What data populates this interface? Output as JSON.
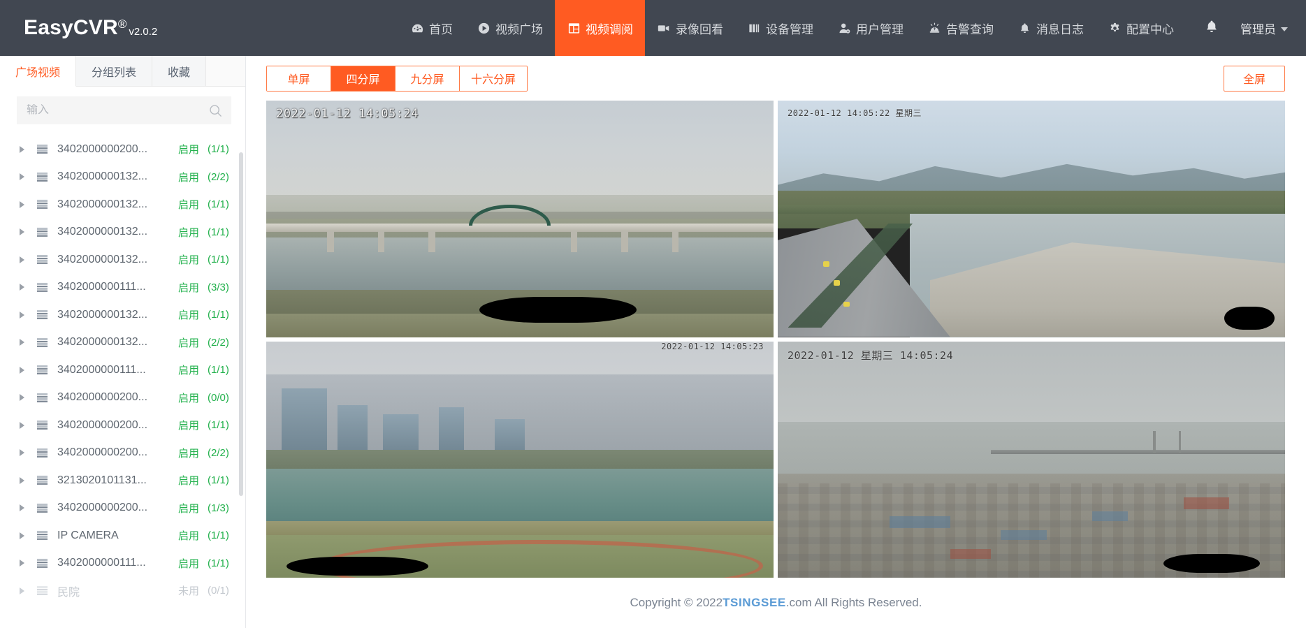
{
  "app": {
    "brand_name": "EasyCVR",
    "brand_reg": "®",
    "brand_version": "v2.0.2",
    "accent_color": "#ff5b22",
    "header_bg": "#414751",
    "enabled_color": "#22b14c"
  },
  "nav": {
    "items": [
      {
        "label": "首页",
        "icon": "dashboard-icon",
        "active": false
      },
      {
        "label": "视频广场",
        "icon": "play-circle-icon",
        "active": false
      },
      {
        "label": "视频调阅",
        "icon": "layout-icon",
        "active": true
      },
      {
        "label": "录像回看",
        "icon": "video-camera-icon",
        "active": false
      },
      {
        "label": "设备管理",
        "icon": "server-icon",
        "active": false
      },
      {
        "label": "用户管理",
        "icon": "user-gear-icon",
        "active": false
      },
      {
        "label": "告警查询",
        "icon": "alarm-icon",
        "active": false
      },
      {
        "label": "消息日志",
        "icon": "bell-icon",
        "active": false
      },
      {
        "label": "配置中心",
        "icon": "gear-icon",
        "active": false
      }
    ],
    "notification_icon": "bell-icon",
    "user_label": "管理员",
    "user_caret_icon": "chevron-down-icon"
  },
  "sidebar": {
    "tabs": [
      {
        "label": "广场视频",
        "active": true
      },
      {
        "label": "分组列表",
        "active": false
      },
      {
        "label": "收藏",
        "active": false
      }
    ],
    "search": {
      "placeholder": "输入",
      "value": "",
      "icon": "search-icon"
    },
    "status_enabled": "启用",
    "status_disabled": "未用",
    "tree": [
      {
        "label": "3402000000200...",
        "status": "启用",
        "count": "(1/1)",
        "enabled": true
      },
      {
        "label": "3402000000132...",
        "status": "启用",
        "count": "(2/2)",
        "enabled": true
      },
      {
        "label": "3402000000132...",
        "status": "启用",
        "count": "(1/1)",
        "enabled": true
      },
      {
        "label": "3402000000132...",
        "status": "启用",
        "count": "(1/1)",
        "enabled": true
      },
      {
        "label": "3402000000132...",
        "status": "启用",
        "count": "(1/1)",
        "enabled": true
      },
      {
        "label": "3402000000111...",
        "status": "启用",
        "count": "(3/3)",
        "enabled": true
      },
      {
        "label": "3402000000132...",
        "status": "启用",
        "count": "(1/1)",
        "enabled": true
      },
      {
        "label": "3402000000132...",
        "status": "启用",
        "count": "(2/2)",
        "enabled": true
      },
      {
        "label": "3402000000111...",
        "status": "启用",
        "count": "(1/1)",
        "enabled": true
      },
      {
        "label": "3402000000200...",
        "status": "启用",
        "count": "(0/0)",
        "enabled": true
      },
      {
        "label": "3402000000200...",
        "status": "启用",
        "count": "(1/1)",
        "enabled": true
      },
      {
        "label": "3402000000200...",
        "status": "启用",
        "count": "(2/2)",
        "enabled": true
      },
      {
        "label": "3213020101131...",
        "status": "启用",
        "count": "(1/1)",
        "enabled": true
      },
      {
        "label": "3402000000200...",
        "status": "启用",
        "count": "(1/3)",
        "enabled": true
      },
      {
        "label": "IP CAMERA",
        "status": "启用",
        "count": "(1/1)",
        "enabled": true
      },
      {
        "label": "3402000000111...",
        "status": "启用",
        "count": "(1/1)",
        "enabled": true
      },
      {
        "label": "民院",
        "status": "未用",
        "count": "(0/1)",
        "enabled": false
      }
    ]
  },
  "toolbar": {
    "split_buttons": [
      {
        "label": "单屏",
        "active": false
      },
      {
        "label": "四分屏",
        "active": true
      },
      {
        "label": "九分屏",
        "active": false
      },
      {
        "label": "十六分屏",
        "active": false
      }
    ],
    "fullscreen_label": "全屏"
  },
  "videos": [
    {
      "position": "top-left",
      "osd": "2022-01-12  14:05:24",
      "osd_style": "white"
    },
    {
      "position": "top-right",
      "osd": "2022-01-12 14:05:22 星期三",
      "osd_style": "dark-small"
    },
    {
      "position": "bottom-left",
      "osd": "2022-01-12 14:05:23",
      "osd_style": "dark-small-right"
    },
    {
      "position": "bottom-right",
      "osd": "2022-01-12  星期三  14:05:24",
      "osd_style": "dark"
    }
  ],
  "footer": {
    "prefix": "Copyright © 2022 ",
    "brand": "TSINGSEE",
    "suffix": ".com All Rights Reserved."
  }
}
